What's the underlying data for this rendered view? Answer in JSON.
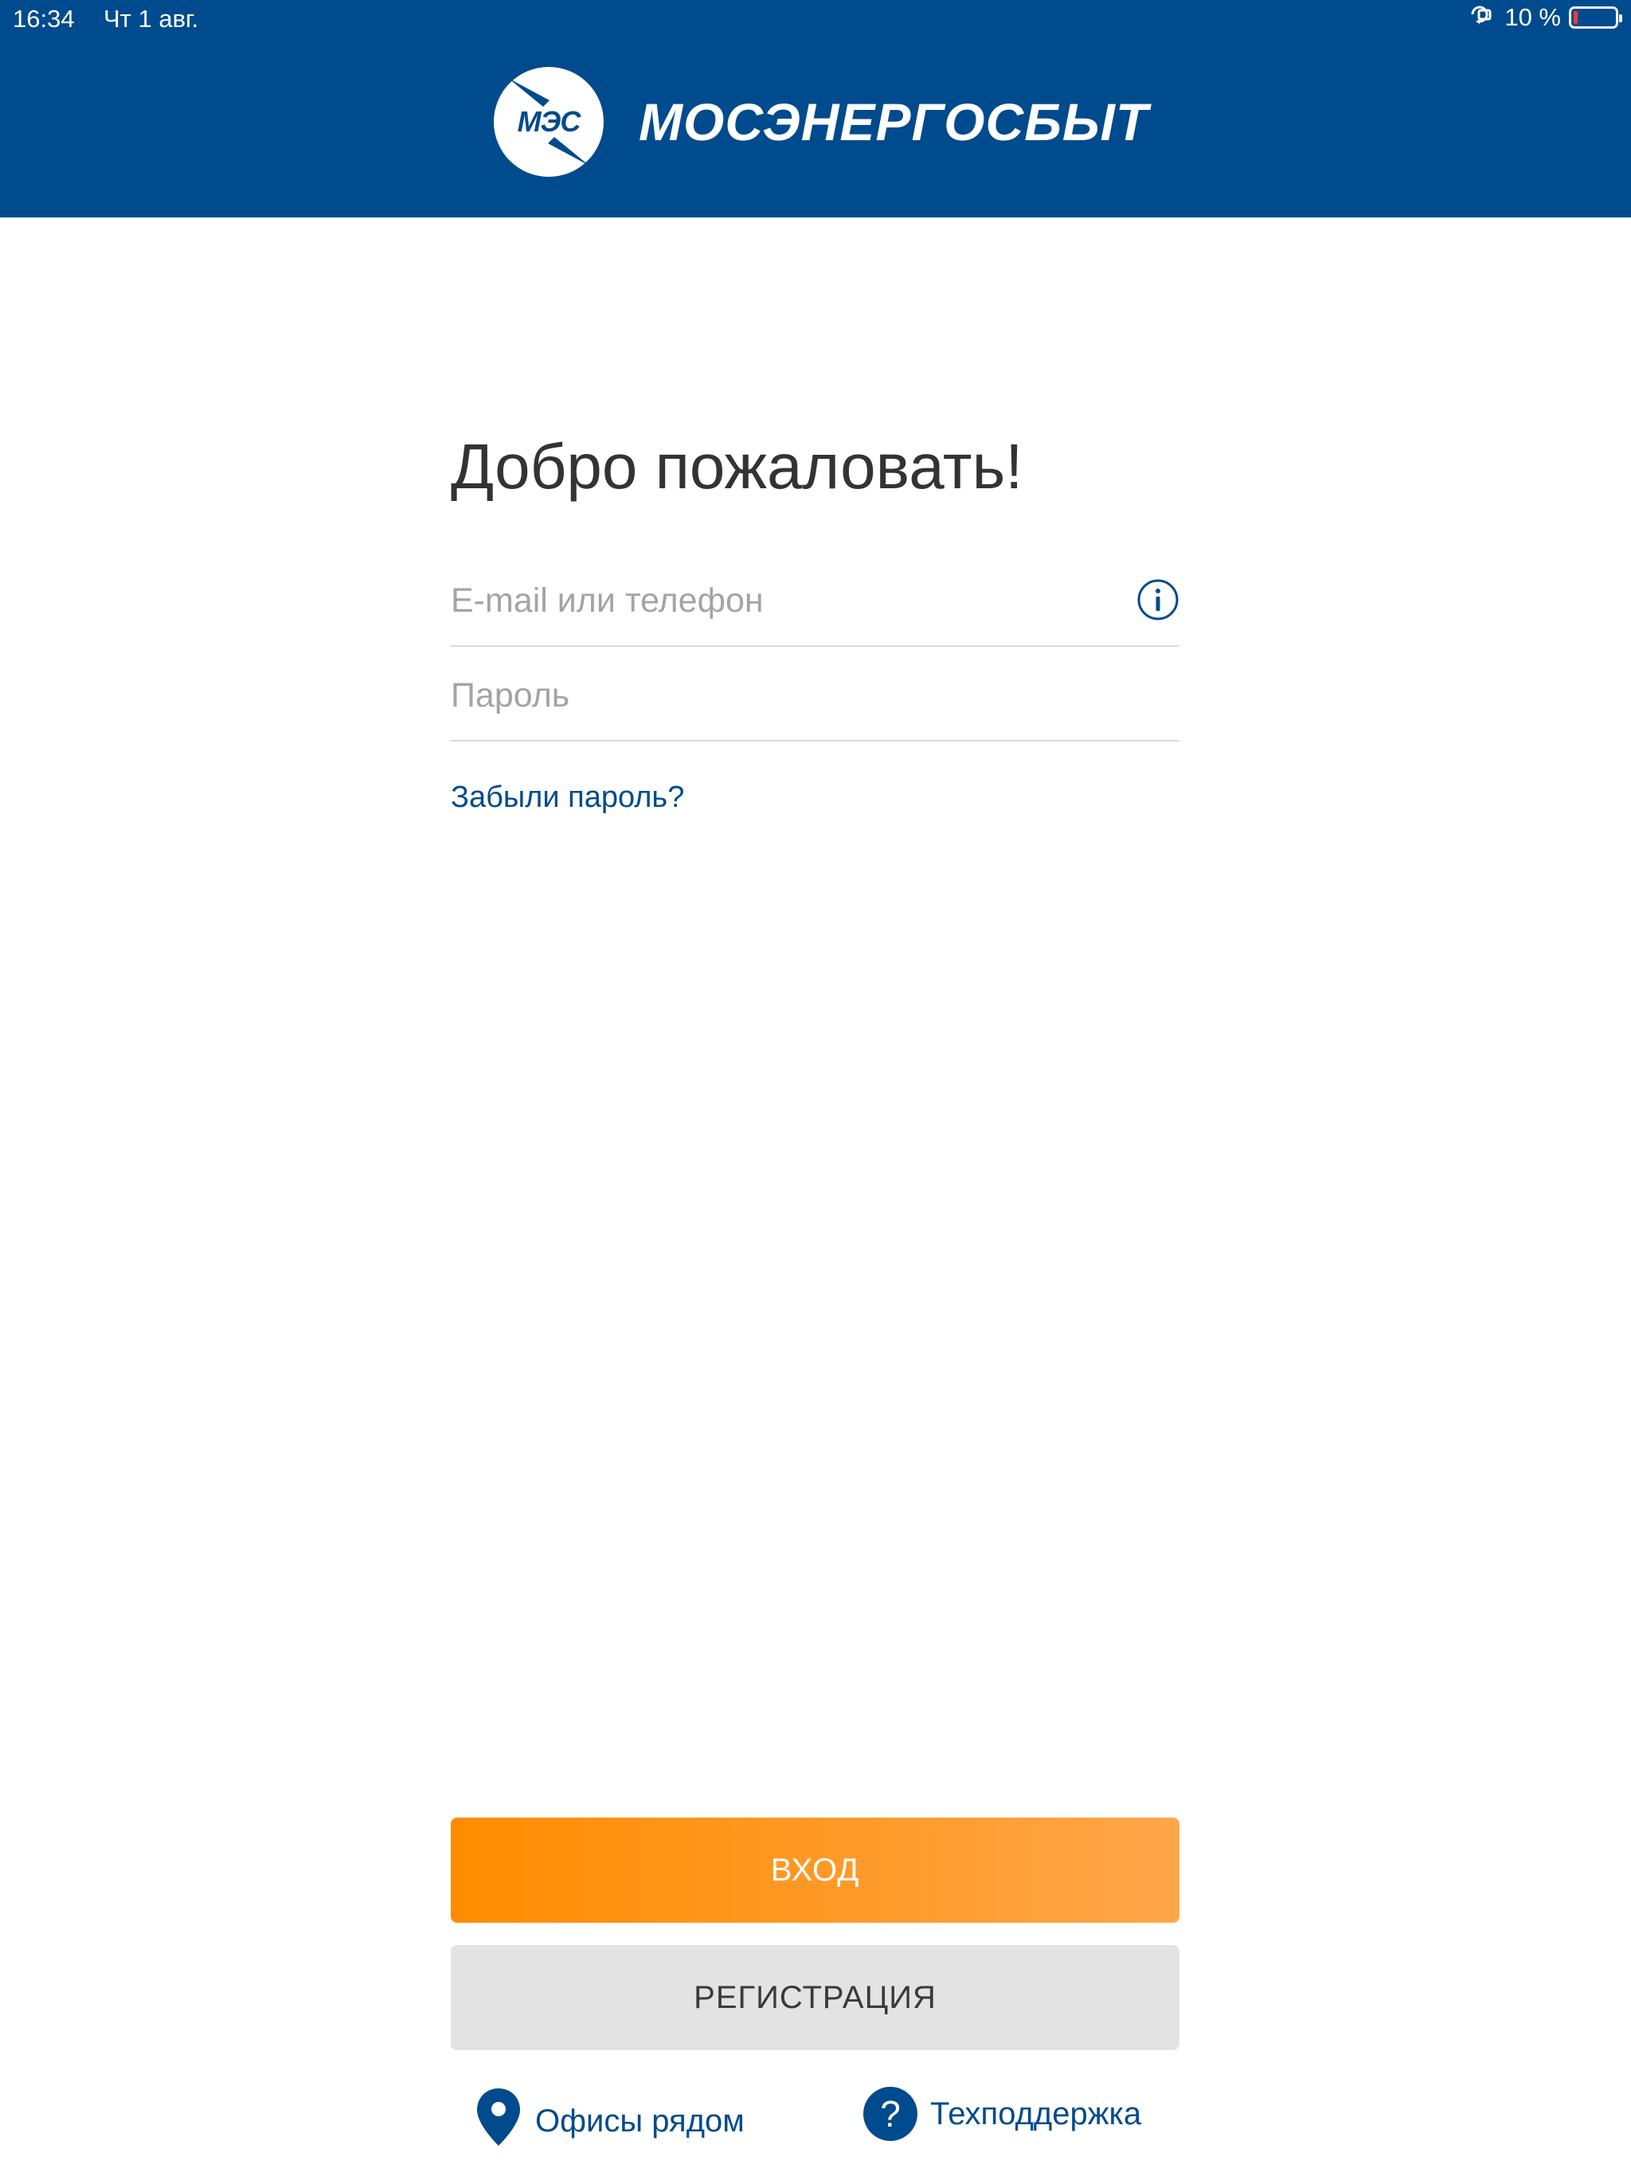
{
  "status_bar": {
    "time": "16:34",
    "date": "Чт 1 авг.",
    "battery_percent": "10 %",
    "battery_level": 0.1,
    "battery_color": "#ff3b30"
  },
  "header": {
    "logo_text": "МЭС",
    "brand_name": "МОСЭНЕРГОСБЫТ",
    "background_color": "#004b8d"
  },
  "login_form": {
    "title": "Добро пожаловать!",
    "email_field": {
      "placeholder": "E-mail или телефон",
      "value": "",
      "icon": "info-icon"
    },
    "password_field": {
      "placeholder": "Пароль",
      "value": ""
    },
    "forgot_password": "Забыли пароль?"
  },
  "buttons": {
    "login": "ВХОД",
    "register": "РЕГИСТРАЦИЯ",
    "accent_color": "#ff8c00"
  },
  "footer_links": {
    "offices": {
      "label": "Офисы рядом",
      "icon": "location-pin-icon"
    },
    "support": {
      "label": "Техподдержка",
      "icon": "question-icon"
    }
  }
}
